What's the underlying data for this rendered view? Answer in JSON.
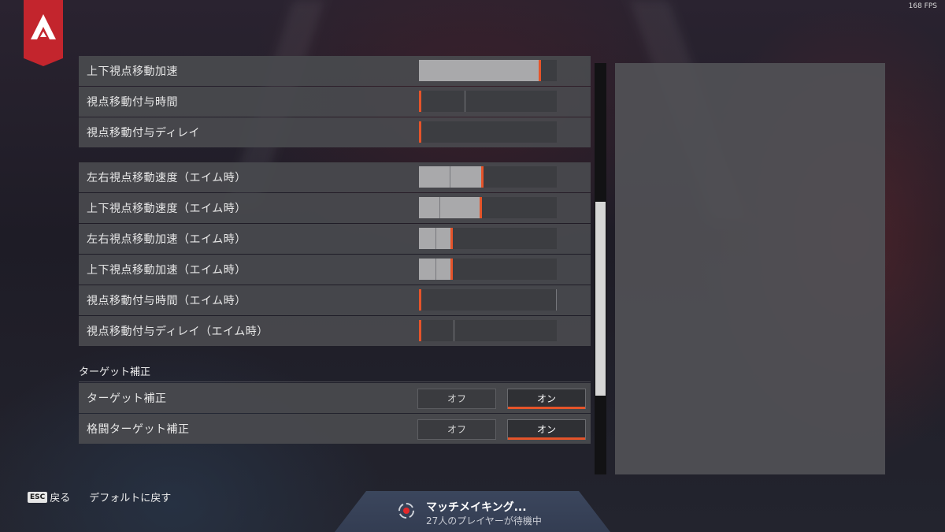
{
  "fps": "168 FPS",
  "colors": {
    "accent": "#e5542a",
    "logo": "#c3252d",
    "panel": "#48494e"
  },
  "icons": {
    "logo": "apex-logo-icon",
    "matchmaking": "matchmaking-spinner-icon"
  },
  "sliders_group_1": [
    {
      "label": "上下視点移動加速",
      "value": 0.87,
      "default": 0.87
    },
    {
      "label": "視点移動付与時間",
      "value": 0.0,
      "default": 0.33
    },
    {
      "label": "視点移動付与ディレイ",
      "value": 0.0,
      "default": 0.0
    }
  ],
  "sliders_group_2": [
    {
      "label": "左右視点移動速度（エイム時）",
      "value": 0.45,
      "default": 0.22
    },
    {
      "label": "上下視点移動速度（エイム時）",
      "value": 0.44,
      "default": 0.15
    },
    {
      "label": "左右視点移動加速（エイム時）",
      "value": 0.23,
      "default": 0.12
    },
    {
      "label": "上下視点移動加速（エイム時）",
      "value": 0.23,
      "default": 0.12
    },
    {
      "label": "視点移動付与時間（エイム時）",
      "value": 0.0,
      "default": 1.0
    },
    {
      "label": "視点移動付与ディレイ（エイム時）",
      "value": 0.0,
      "default": 0.25
    }
  ],
  "target_section": {
    "title": "ターゲット補正",
    "rows": [
      {
        "label": "ターゲット補正",
        "off": "オフ",
        "on": "オン",
        "selected": "on"
      },
      {
        "label": "格闘ターゲット補正",
        "off": "オフ",
        "on": "オン",
        "selected": "on"
      }
    ]
  },
  "scroll": {
    "position": 0.34
  },
  "footer": {
    "esc_key": "ESC",
    "back": "戻る",
    "reset_default": "デフォルトに戻す"
  },
  "matchmaking": {
    "title": "マッチメイキング...",
    "subtitle": "27人のプレイヤーが待機中"
  }
}
